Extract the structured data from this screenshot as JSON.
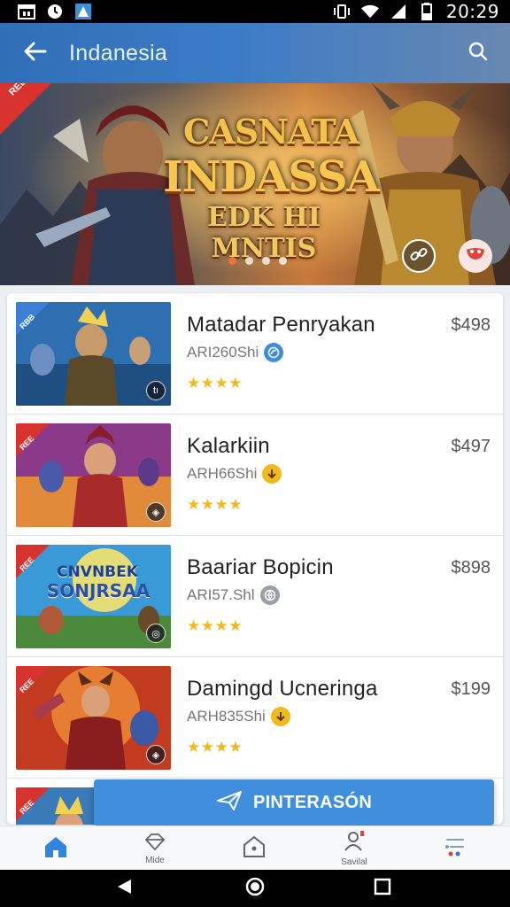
{
  "status_bar": {
    "time": "20:29",
    "left_icons": [
      "calendar-icon",
      "clock-icon",
      "app-icon"
    ],
    "right_icons": [
      "vibrate-icon",
      "wifi-icon",
      "signal-icon",
      "battery-icon"
    ]
  },
  "app_bar": {
    "title": "Indanesia",
    "back_icon": "arrow-left-icon",
    "search_icon": "search-icon",
    "color": "#2f6fb8"
  },
  "hero": {
    "ribbon": "REE",
    "title_line1": "CASNATA",
    "title_line2": "INDASSA",
    "subtitle": "EDK HI MNTIS",
    "dot_count": 4,
    "active_dot": 0,
    "link_icon": "link-icon",
    "mask_icon": "mask-icon"
  },
  "items": [
    {
      "title": "Matadar Penryakan",
      "code": "ARI260Shi",
      "price": "$498",
      "rating": "★★★★",
      "badge": "RBB",
      "code_icon": "globe-icon",
      "code_color": "#3e8ee0",
      "corner": "tı"
    },
    {
      "title": "Kalarkiin",
      "code": "ARH66Shi",
      "price": "$497",
      "rating": "★★★★",
      "badge": "REE",
      "code_icon": "arrow-down-icon",
      "code_color": "#f2b91d",
      "corner": "◈"
    },
    {
      "title": "Baariar Bopicin",
      "code": "ARI57.Shl",
      "price": "$898",
      "rating": "★★★★",
      "badge": "REE",
      "code_icon": "globe-icon",
      "code_color": "#9aa0a6",
      "corner": "◎",
      "thumb_text_1": "CNVNBEK",
      "thumb_text_2": "SONJRSAA"
    },
    {
      "title": "Damingd Ucneringa",
      "code": "ARH835Shi",
      "price": "$199",
      "rating": "★★★★",
      "badge": "REE",
      "code_icon": "arrow-down-icon",
      "code_color": "#f2b91d",
      "corner": "◈"
    },
    {
      "badge": "REE"
    }
  ],
  "action_button": {
    "label": "PINTERASÓN",
    "icon": "send-icon",
    "color": "#3f8fdd"
  },
  "bottom_nav": [
    {
      "label": "",
      "icon": "home-icon"
    },
    {
      "label": "Mide",
      "icon": "diamond-icon"
    },
    {
      "label": "",
      "icon": "house-outline-icon"
    },
    {
      "label": "Savilal",
      "icon": "profile-icon"
    },
    {
      "label": "",
      "icon": "menu-icon"
    }
  ],
  "system_nav": [
    "back-triangle-icon",
    "home-circle-icon",
    "recents-square-icon"
  ]
}
